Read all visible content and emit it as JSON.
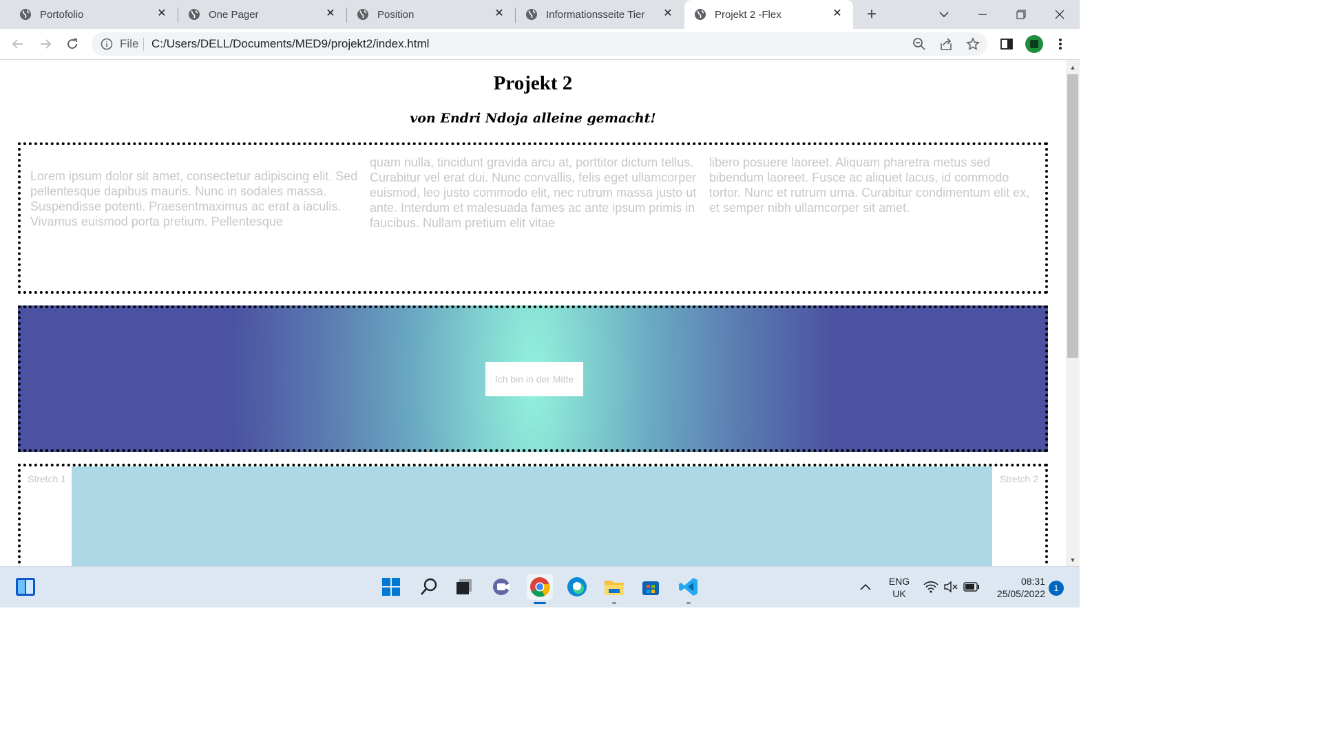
{
  "tabs": [
    {
      "title": "Portofolio",
      "active": false
    },
    {
      "title": "One Pager",
      "active": false
    },
    {
      "title": "Position",
      "active": false
    },
    {
      "title": "Informationsseite Tier",
      "active": false
    },
    {
      "title": "Projekt 2 -Flex",
      "active": true
    }
  ],
  "toolbar": {
    "omnibox_scheme": "File",
    "url": "C:/Users/DELL/Documents/MED9/projekt2/index.html"
  },
  "page": {
    "title": "Projekt 2",
    "subtitle": "von Endri Ndoja alleine gemacht!",
    "columns": [
      "Lorem ipsum dolor sit amet, consectetur adipiscing elit. Sed pellentesque dapibus mauris. Nunc in sodales massa. Suspendisse potenti. Praesentmaximus ac erat a iaculis. Vivamus euismod porta pretium. Pellentesque",
      "quam nulla, tincidunt gravida arcu at, porttitor dictum tellus. Curabitur vel erat dui. Nunc convallis, felis eget ullamcorper euismod, leo justo commodo elit, nec rutrum massa justo ut ante. Interdum et malesuada fames ac ante ipsum primis in faucibus. Nullam pretium elit vitae",
      "libero posuere laoreet. Aliquam pharetra metus sed bibendum laoreet. Fusce ac aliquet lacus, id commodo tortor. Nunc et rutrum urna. Curabitur condimentum elit ex, et semper nibh ullamcorper sit amet."
    ],
    "center_box_text": "Ich bin in der Mitte",
    "stretch1": "Stretch 1",
    "stretch2": "Stretch 2",
    "colors": {
      "gradient_center": "#93f2dc",
      "gradient_edge": "#4a52a1",
      "stretch_middle": "#add8e6"
    }
  },
  "taskbar": {
    "apps": [
      "widgets-icon",
      "start-icon",
      "search-icon",
      "task-view-icon",
      "chat-icon",
      "chrome-icon",
      "edge-icon",
      "file-explorer-icon",
      "store-icon",
      "vscode-icon"
    ],
    "language_line1": "ENG",
    "language_line2": "UK",
    "time": "08:31",
    "date": "25/05/2022",
    "notifications": "1"
  }
}
